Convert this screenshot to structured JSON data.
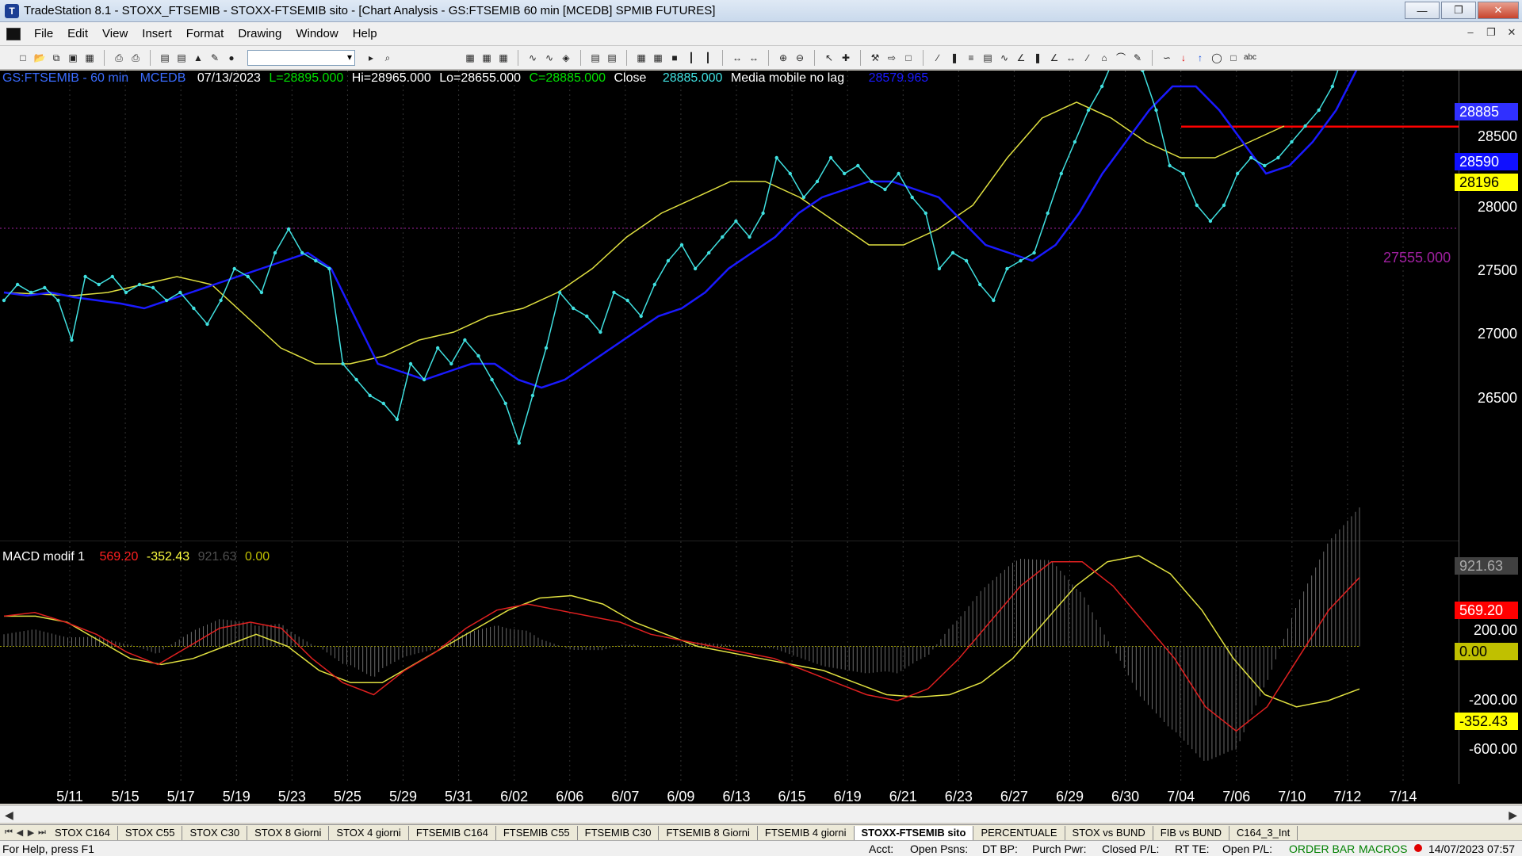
{
  "window": {
    "title": "TradeStation 8.1 - STOXX_FTSEMIB - STOXX-FTSEMIB sito - [Chart Analysis - GS:FTSEMIB  60 min  [MCEDB] SPMIB FUTURES]"
  },
  "menu": [
    "File",
    "Edit",
    "View",
    "Insert",
    "Format",
    "Drawing",
    "Window",
    "Help"
  ],
  "toolbar": {
    "combo_value": ""
  },
  "chart": {
    "header": {
      "symbol": "GS:FTSEMIB - 60 min",
      "code": "MCEDB",
      "date": "07/13/2023",
      "last": "L=28895.000",
      "high": "Hi=28965.000",
      "low": "Lo=28655.000",
      "close": "C=28885.000",
      "close_label": "Close",
      "close_value": "28885.000",
      "ma_label": "Media mobile no lag",
      "ma_value": "28579.965"
    },
    "price_badges": {
      "last": "28885",
      "ma": "28590",
      "line": "28196"
    },
    "hline_label": "27555.000",
    "price_axis": [
      "28500",
      "28000",
      "27500",
      "27000",
      "26500"
    ],
    "macd": {
      "label": "MACD modif 1",
      "v1": "569.20",
      "v2": "-352.43",
      "v3": "921.63",
      "v4": "0.00",
      "badges": {
        "hist": "921.63",
        "macd": "569.20",
        "zero": "0.00",
        "signal": "-352.43"
      },
      "axis": [
        "200.00",
        "-200.00",
        "-600.00"
      ]
    },
    "dates": [
      "5/11",
      "5/15",
      "5/17",
      "5/19",
      "5/23",
      "5/25",
      "5/29",
      "5/31",
      "6/02",
      "6/06",
      "6/07",
      "6/09",
      "6/13",
      "6/15",
      "6/19",
      "6/21",
      "6/23",
      "6/27",
      "6/29",
      "6/30",
      "7/04",
      "7/06",
      "7/10",
      "7/12",
      "7/14"
    ],
    "colors": {
      "price": "#40e0e0",
      "ma_fast": "#1a1aff",
      "ma_slow": "#e0e040",
      "hline": "#ff0000",
      "dashline": "#a020a0",
      "macd": "#e02020",
      "signal": "#e0e040"
    },
    "series": {
      "price": [
        27100,
        27200,
        27150,
        27180,
        27100,
        26850,
        27250,
        27200,
        27250,
        27150,
        27200,
        27180,
        27100,
        27150,
        27050,
        26950,
        27100,
        27300,
        27250,
        27150,
        27400,
        27550,
        27400,
        27350,
        27300,
        26700,
        26600,
        26500,
        26450,
        26350,
        26700,
        26600,
        26800,
        26700,
        26850,
        26750,
        26600,
        26450,
        26200,
        26500,
        26800,
        27150,
        27050,
        27000,
        26900,
        27150,
        27100,
        27000,
        27200,
        27350,
        27450,
        27300,
        27400,
        27500,
        27600,
        27500,
        27650,
        28000,
        27900,
        27750,
        27850,
        28000,
        27900,
        27950,
        27850,
        27800,
        27900,
        27750,
        27650,
        27300,
        27400,
        27350,
        27200,
        27100,
        27300,
        27350,
        27400,
        27650,
        27900,
        28100,
        28300,
        28450,
        28650,
        28600,
        28550,
        28300,
        27950,
        27900,
        27700,
        27600,
        27700,
        27900,
        28000,
        27950,
        28000,
        28100,
        28200,
        28300,
        28450,
        28700,
        28885
      ],
      "ma_fast": [
        27150,
        27130,
        27150,
        27120,
        27100,
        27080,
        27050,
        27100,
        27150,
        27200,
        27250,
        27300,
        27350,
        27400,
        27300,
        27000,
        26700,
        26650,
        26600,
        26650,
        26700,
        26700,
        26600,
        26550,
        26600,
        26700,
        26800,
        26900,
        27000,
        27050,
        27150,
        27300,
        27400,
        27500,
        27650,
        27750,
        27800,
        27850,
        27850,
        27800,
        27750,
        27600,
        27450,
        27400,
        27350,
        27450,
        27650,
        27900,
        28100,
        28300,
        28450,
        28450,
        28300,
        28100,
        27900,
        27950,
        28100,
        28300,
        28590
      ],
      "ma_slow": [
        27150,
        27140,
        27130,
        27150,
        27200,
        27250,
        27200,
        27000,
        26800,
        26700,
        26700,
        26750,
        26850,
        26900,
        27000,
        27050,
        27150,
        27300,
        27500,
        27650,
        27750,
        27850,
        27850,
        27750,
        27600,
        27450,
        27450,
        27550,
        27700,
        28000,
        28250,
        28350,
        28250,
        28100,
        28000,
        28000,
        28100,
        28200
      ],
      "macd": [
        250,
        280,
        200,
        100,
        -50,
        -150,
        0,
        150,
        200,
        150,
        -100,
        -300,
        -400,
        -200,
        -50,
        150,
        300,
        350,
        300,
        250,
        200,
        100,
        50,
        0,
        -50,
        -100,
        -200,
        -300,
        -400,
        -450,
        -350,
        -100,
        200,
        500,
        700,
        700,
        500,
        200,
        -100,
        -500,
        -700,
        -500,
        -100,
        300,
        569.2
      ],
      "signal": [
        250,
        250,
        200,
        50,
        -100,
        -150,
        -100,
        0,
        100,
        0,
        -200,
        -300,
        -300,
        -150,
        0,
        150,
        300,
        400,
        420,
        350,
        200,
        100,
        0,
        -50,
        -100,
        -150,
        -200,
        -300,
        -400,
        -420,
        -400,
        -300,
        -100,
        200,
        500,
        700,
        750,
        600,
        300,
        -100,
        -400,
        -500,
        -450,
        -352.43
      ]
    }
  },
  "tabs": [
    "STOX C164",
    "STOX C55",
    "STOX  C30",
    "STOX  8 Giorni",
    "STOX 4 giorni",
    "FTSEMIB C164",
    "FTSEMIB C55",
    "FTSEMIB C30",
    "FTSEMIB  8 Giorni",
    "FTSEMIB  4 giorni",
    "STOXX-FTSEMIB sito",
    "PERCENTUALE",
    "STOX vs BUND",
    "FIB vs BUND",
    "C164_3_Int"
  ],
  "status": {
    "help": "For Help, press F1",
    "acct": "Acct:",
    "open_psns": "Open Psns:",
    "dt_bp": "DT BP:",
    "purch_pwr": "Purch Pwr:",
    "closed_pl": "Closed P/L:",
    "rt_te": "RT TE:",
    "open_pl": "Open P/L:",
    "order_bar": "ORDER BAR",
    "macros": "MACROS",
    "datetime": "14/07/2023 07:57"
  }
}
